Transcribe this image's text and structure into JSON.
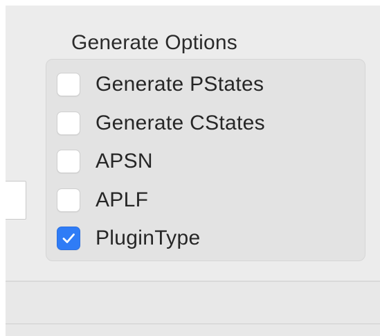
{
  "generate_options": {
    "title": "Generate Options",
    "options": [
      {
        "label": "Generate PStates",
        "checked": false,
        "icon": "checkbox-unchecked-icon"
      },
      {
        "label": "Generate CStates",
        "checked": false,
        "icon": "checkbox-unchecked-icon"
      },
      {
        "label": "APSN",
        "checked": false,
        "icon": "checkbox-unchecked-icon"
      },
      {
        "label": "APLF",
        "checked": false,
        "icon": "checkbox-unchecked-icon"
      },
      {
        "label": "PluginType",
        "checked": true,
        "icon": "checkbox-checked-icon"
      }
    ]
  },
  "colors": {
    "accent": "#2f7cf6",
    "panel_background": "#ececec",
    "group_background": "#e3e3e3"
  }
}
